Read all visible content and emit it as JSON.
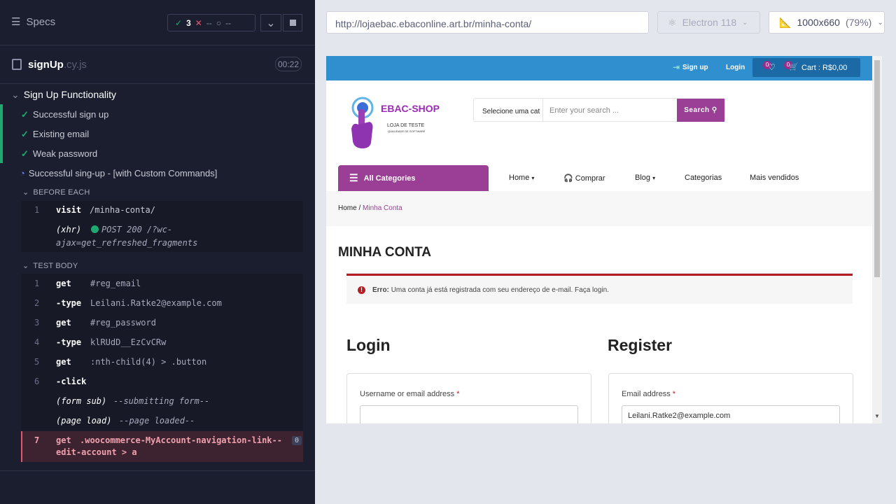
{
  "reporter": {
    "specs_label": "Specs",
    "stats": {
      "passed": "3",
      "failed": "--",
      "pending": "--"
    },
    "file": {
      "name": "signUp",
      "ext": ".cy.js",
      "duration": "00:22"
    },
    "suite_title": "Sign Up Functionality",
    "tests": [
      {
        "title": "Successful sign up",
        "state": "passed"
      },
      {
        "title": "Existing email",
        "state": "passed"
      },
      {
        "title": "Weak password",
        "state": "passed"
      },
      {
        "title": "Successful sing-up - [with Custom Commands]",
        "state": "running"
      }
    ],
    "before_each_label": "BEFORE EACH",
    "before_each": [
      {
        "num": "1",
        "name": "visit",
        "arg": "/minha-conta/"
      }
    ],
    "xhr": {
      "label": "(xhr)",
      "text": "POST 200 /?wc-",
      "text2": "ajax=get_refreshed_fragments"
    },
    "test_body_label": "TEST BODY",
    "body": [
      {
        "num": "1",
        "name": "get",
        "arg": "#reg_email"
      },
      {
        "num": "2",
        "name": "-type",
        "arg": "Leilani.Ratke2@example.com"
      },
      {
        "num": "3",
        "name": "get",
        "arg": "#reg_password"
      },
      {
        "num": "4",
        "name": "-type",
        "arg": "klRUdD__EzCvCRw"
      },
      {
        "num": "5",
        "name": "get",
        "arg": ":nth-child(4) > .button"
      },
      {
        "num": "6",
        "name": "-click",
        "arg": ""
      }
    ],
    "form_sub": {
      "label": "(form sub)",
      "text": "--submitting form--"
    },
    "page_load": {
      "label": "(page load)",
      "text": "--page loaded--"
    },
    "failing": {
      "num": "7",
      "name": "get",
      "arg": ".woocommerce-MyAccount-navigation-link--",
      "arg2": "edit-account > a",
      "count": "0"
    }
  },
  "browser": {
    "url": "http://lojaebac.ebaconline.art.br/minha-conta/",
    "name": "Electron 118",
    "viewport": "1000x660",
    "scale": "(79%)"
  },
  "site": {
    "signup": "Sign up",
    "login": "Login",
    "wishlist_count": "0",
    "cart_count": "0",
    "cart_label": "Cart : R$0,00",
    "brand": "EBAC-SHOP",
    "tagline": "LOJA DE TESTE",
    "tagline2": "QUALIDADE DE SOFTWARE",
    "search_category": "Selecione uma cat",
    "search_placeholder": "Enter your search ...",
    "search_button": "Search",
    "all_categories": "All Categories",
    "nav": [
      "Home",
      "Comprar",
      "Blog",
      "Categorias",
      "Mais vendidos"
    ],
    "crumb_home": "Home",
    "crumb_current": "Minha Conta",
    "page_title": "MINHA CONTA",
    "error_strong": "Erro:",
    "error_text": "Uma conta já está registrada com seu endereço de e-mail. Faça login.",
    "login_heading": "Login",
    "register_heading": "Register",
    "username_label": "Username or email address",
    "email_label": "Email address",
    "email_value": "Leilani.Ratke2@example.com"
  }
}
